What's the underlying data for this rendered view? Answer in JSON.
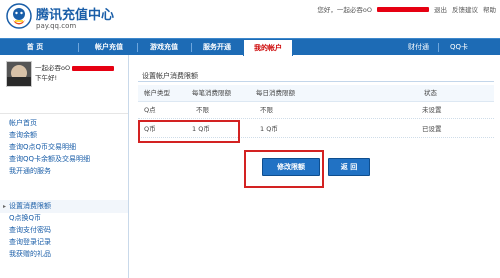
{
  "header": {
    "logo_title": "腾讯充值中心",
    "logo_sub": "pay.qq.com",
    "user_prefix": "您好，一起必吞oO",
    "links": [
      "退出",
      "反馈建议",
      "帮助"
    ]
  },
  "nav": {
    "tabs": [
      "首 页",
      "帐户充值",
      "游戏充值",
      "服务开通",
      "我的帐户"
    ],
    "active_index": 4,
    "right_items": [
      "财付通",
      "QQ卡"
    ]
  },
  "sidebar": {
    "user": {
      "name": "一起必吞oO",
      "greeting": "下午好!"
    },
    "group1": [
      "帐户首页",
      "查询余额",
      "查询Q点Q币交易明细",
      "查询QQ卡余额及交易明细",
      "我开通的服务"
    ],
    "group2": [
      "设置消费限额",
      "Q点换Q币",
      "查询支付密码",
      "查询登录记录",
      "我获赠的礼品"
    ],
    "active_item": "设置消费限额"
  },
  "main": {
    "title": "设置帐户消费限额",
    "columns": [
      "帐户类型",
      "每笔消费限额",
      "每日消费限额",
      "状态"
    ],
    "rows": [
      {
        "type": "Q点",
        "per_tx": "不限",
        "daily": "不限",
        "status": "未设置"
      },
      {
        "type": "Q币",
        "per_tx": "1 Q币",
        "daily": "1 Q币",
        "status": "已设置"
      }
    ],
    "buttons": {
      "modify": "修改限额",
      "back": "返 回"
    }
  },
  "colors": {
    "brand": "#1d6bb5",
    "highlight": "#d32222",
    "redaction": "#e60012"
  }
}
